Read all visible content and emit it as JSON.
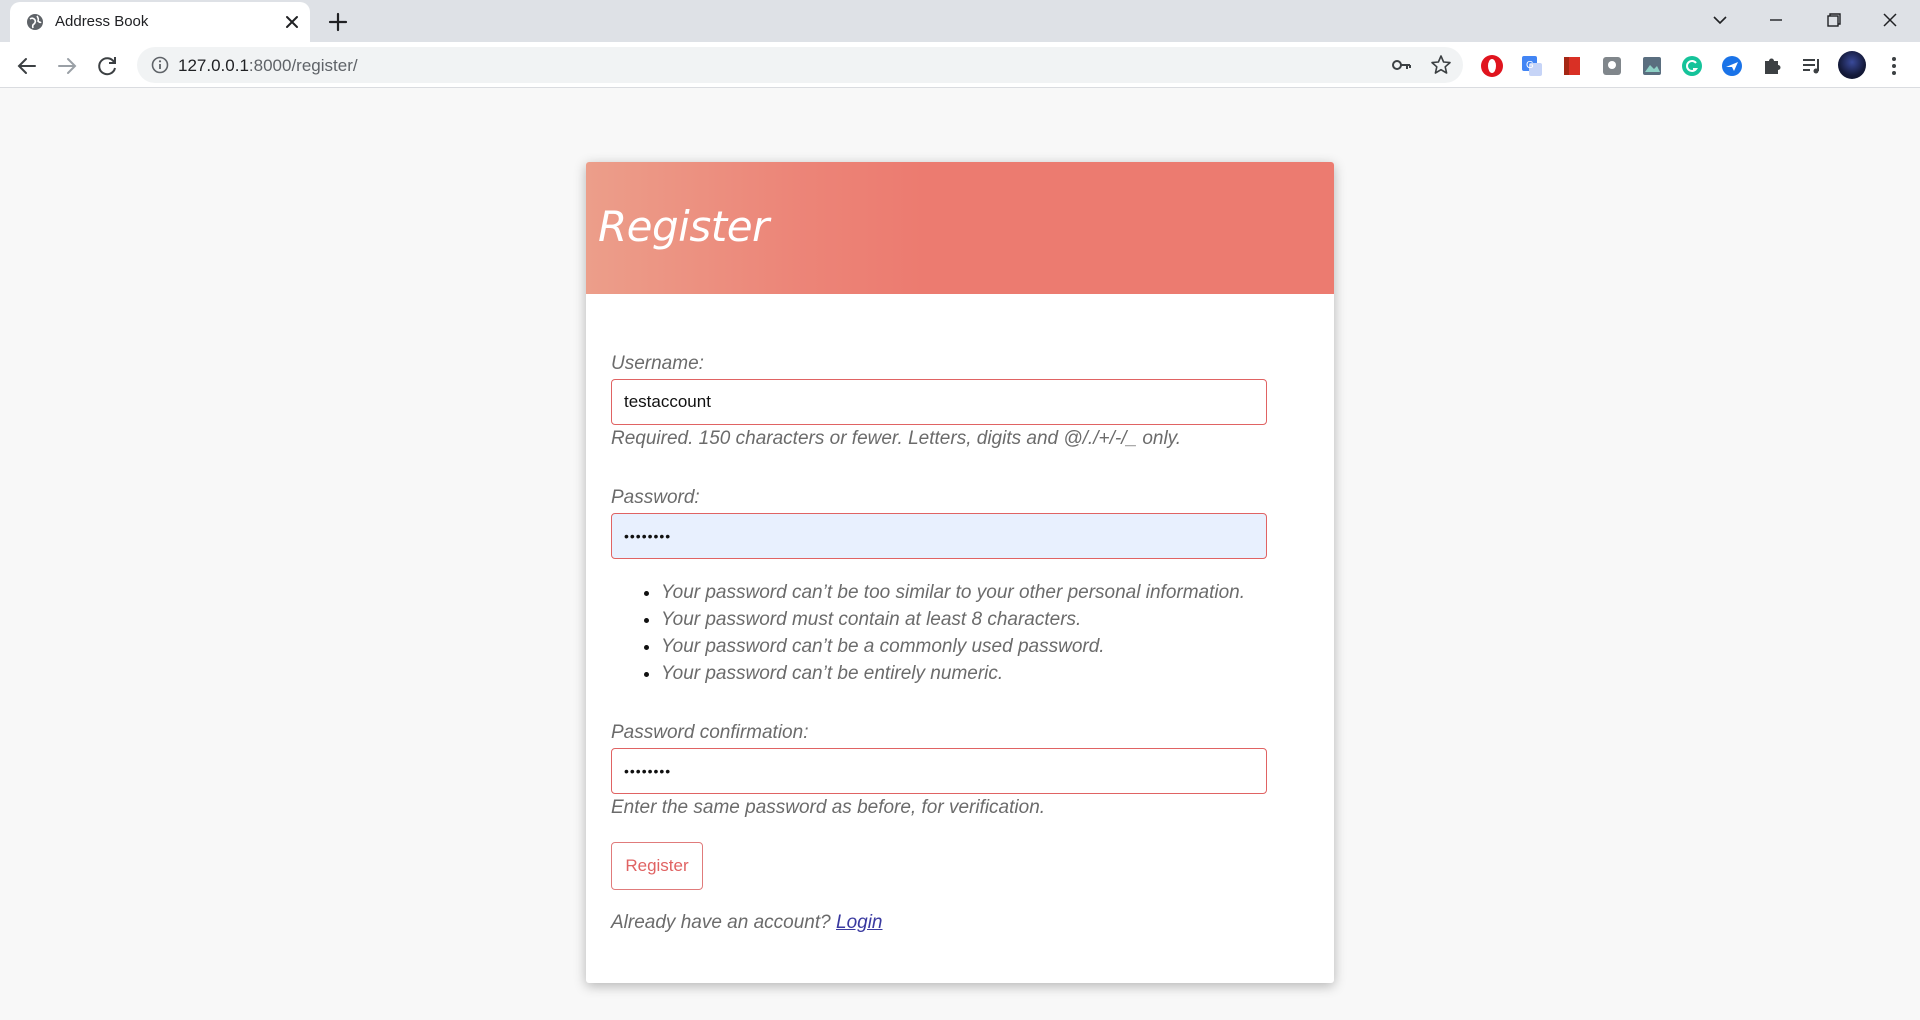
{
  "browser": {
    "tab_title": "Address Book",
    "url_host": "127.0.0.1",
    "url_path": ":8000/register/"
  },
  "icons": {
    "tab_favicon": "globe-icon",
    "tab_close": "close-icon",
    "new_tab": "plus-icon",
    "tab_search": "chevron-down-icon",
    "minimize": "minimize-icon",
    "restore": "restore-icon",
    "close_window": "close-icon",
    "back": "back-arrow-icon",
    "forward": "forward-arrow-icon",
    "reload": "reload-icon",
    "site_info": "info-icon",
    "password_key": "key-icon",
    "bookmark": "star-icon",
    "extensions": [
      "opera-icon",
      "translate-icon",
      "bookmark-red-icon",
      "screen-icon",
      "image-icon",
      "grammarly-icon",
      "plane-icon",
      "puzzle-icon",
      "media-icon"
    ],
    "menu": "more-vert-icon"
  },
  "colors": {
    "header_start": "#ec9e8a",
    "header_end": "#ec7b70",
    "field_border": "#e06363",
    "autofill_bg": "#e8f0fe"
  },
  "form": {
    "title": "Register",
    "username": {
      "label": "Username:",
      "value": "testaccount",
      "help": "Required. 150 characters or fewer. Letters, digits and @/./+/-/_ only."
    },
    "password": {
      "label": "Password:",
      "value": "••••••••",
      "rules": [
        "Your password can’t be too similar to your other personal information.",
        "Your password must contain at least 8 characters.",
        "Your password can’t be a commonly used password.",
        "Your password can’t be entirely numeric."
      ]
    },
    "password_confirmation": {
      "label": "Password confirmation:",
      "value": "••••••••",
      "help": "Enter the same password as before, for verification."
    },
    "submit_label": "Register",
    "footer_text": "Already have an account? ",
    "login_link": "Login"
  }
}
